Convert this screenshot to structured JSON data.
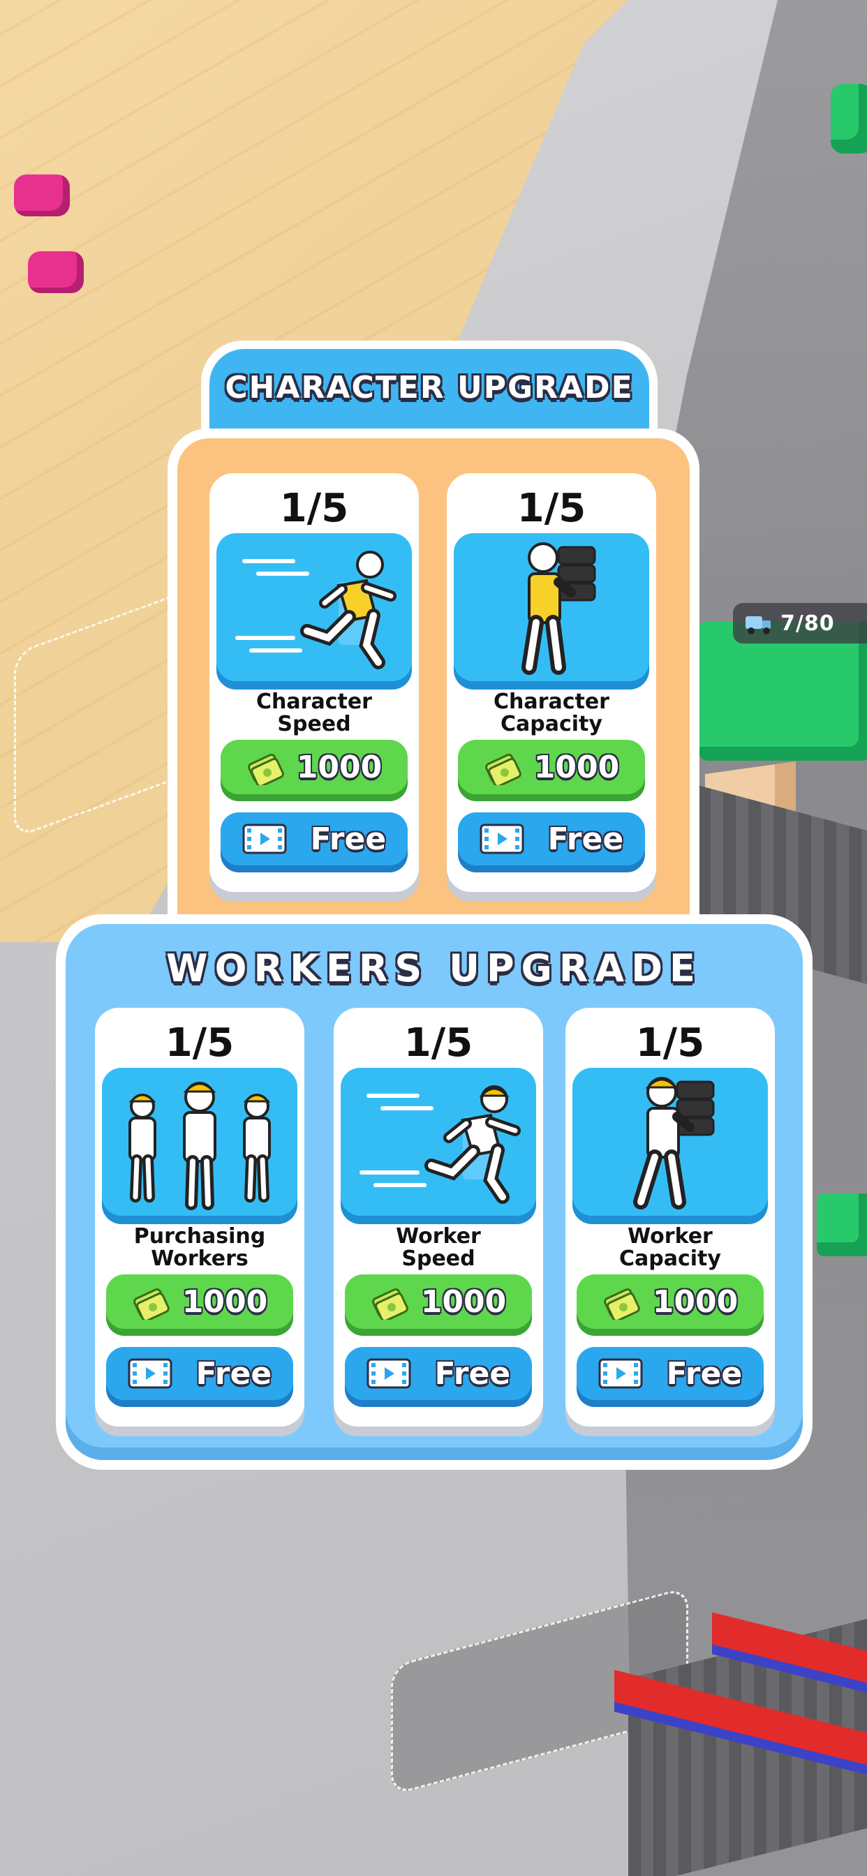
{
  "hud": {
    "counter_text": "7/80",
    "counter_icon": "truck-icon"
  },
  "character_upgrade": {
    "title": "CHARACTER UPGRADE",
    "cards": [
      {
        "level": "1/5",
        "name_line1": "Character",
        "name_line2": "Speed",
        "cost": "1000",
        "free_label": "Free",
        "icon": "running-character-icon"
      },
      {
        "level": "1/5",
        "name_line1": "Character",
        "name_line2": "Capacity",
        "cost": "1000",
        "free_label": "Free",
        "icon": "carrying-character-icon"
      }
    ]
  },
  "workers_upgrade": {
    "title": "WORKERS UPGRADE",
    "cards": [
      {
        "level": "1/5",
        "name_line1": "Purchasing",
        "name_line2": "Workers",
        "cost": "1000",
        "free_label": "Free",
        "icon": "worker-group-icon"
      },
      {
        "level": "1/5",
        "name_line1": "Worker",
        "name_line2": "Speed",
        "cost": "1000",
        "free_label": "Free",
        "icon": "running-worker-icon"
      },
      {
        "level": "1/5",
        "name_line1": "Worker",
        "name_line2": "Capacity",
        "cost": "1000",
        "free_label": "Free",
        "icon": "carrying-worker-icon"
      }
    ]
  },
  "colors": {
    "cost_button": "#5fd74d",
    "free_button": "#2ba7ee",
    "character_panel": "#fbc37f",
    "workers_panel": "#7ec9fb",
    "title_tab": "#3fb6f2"
  }
}
